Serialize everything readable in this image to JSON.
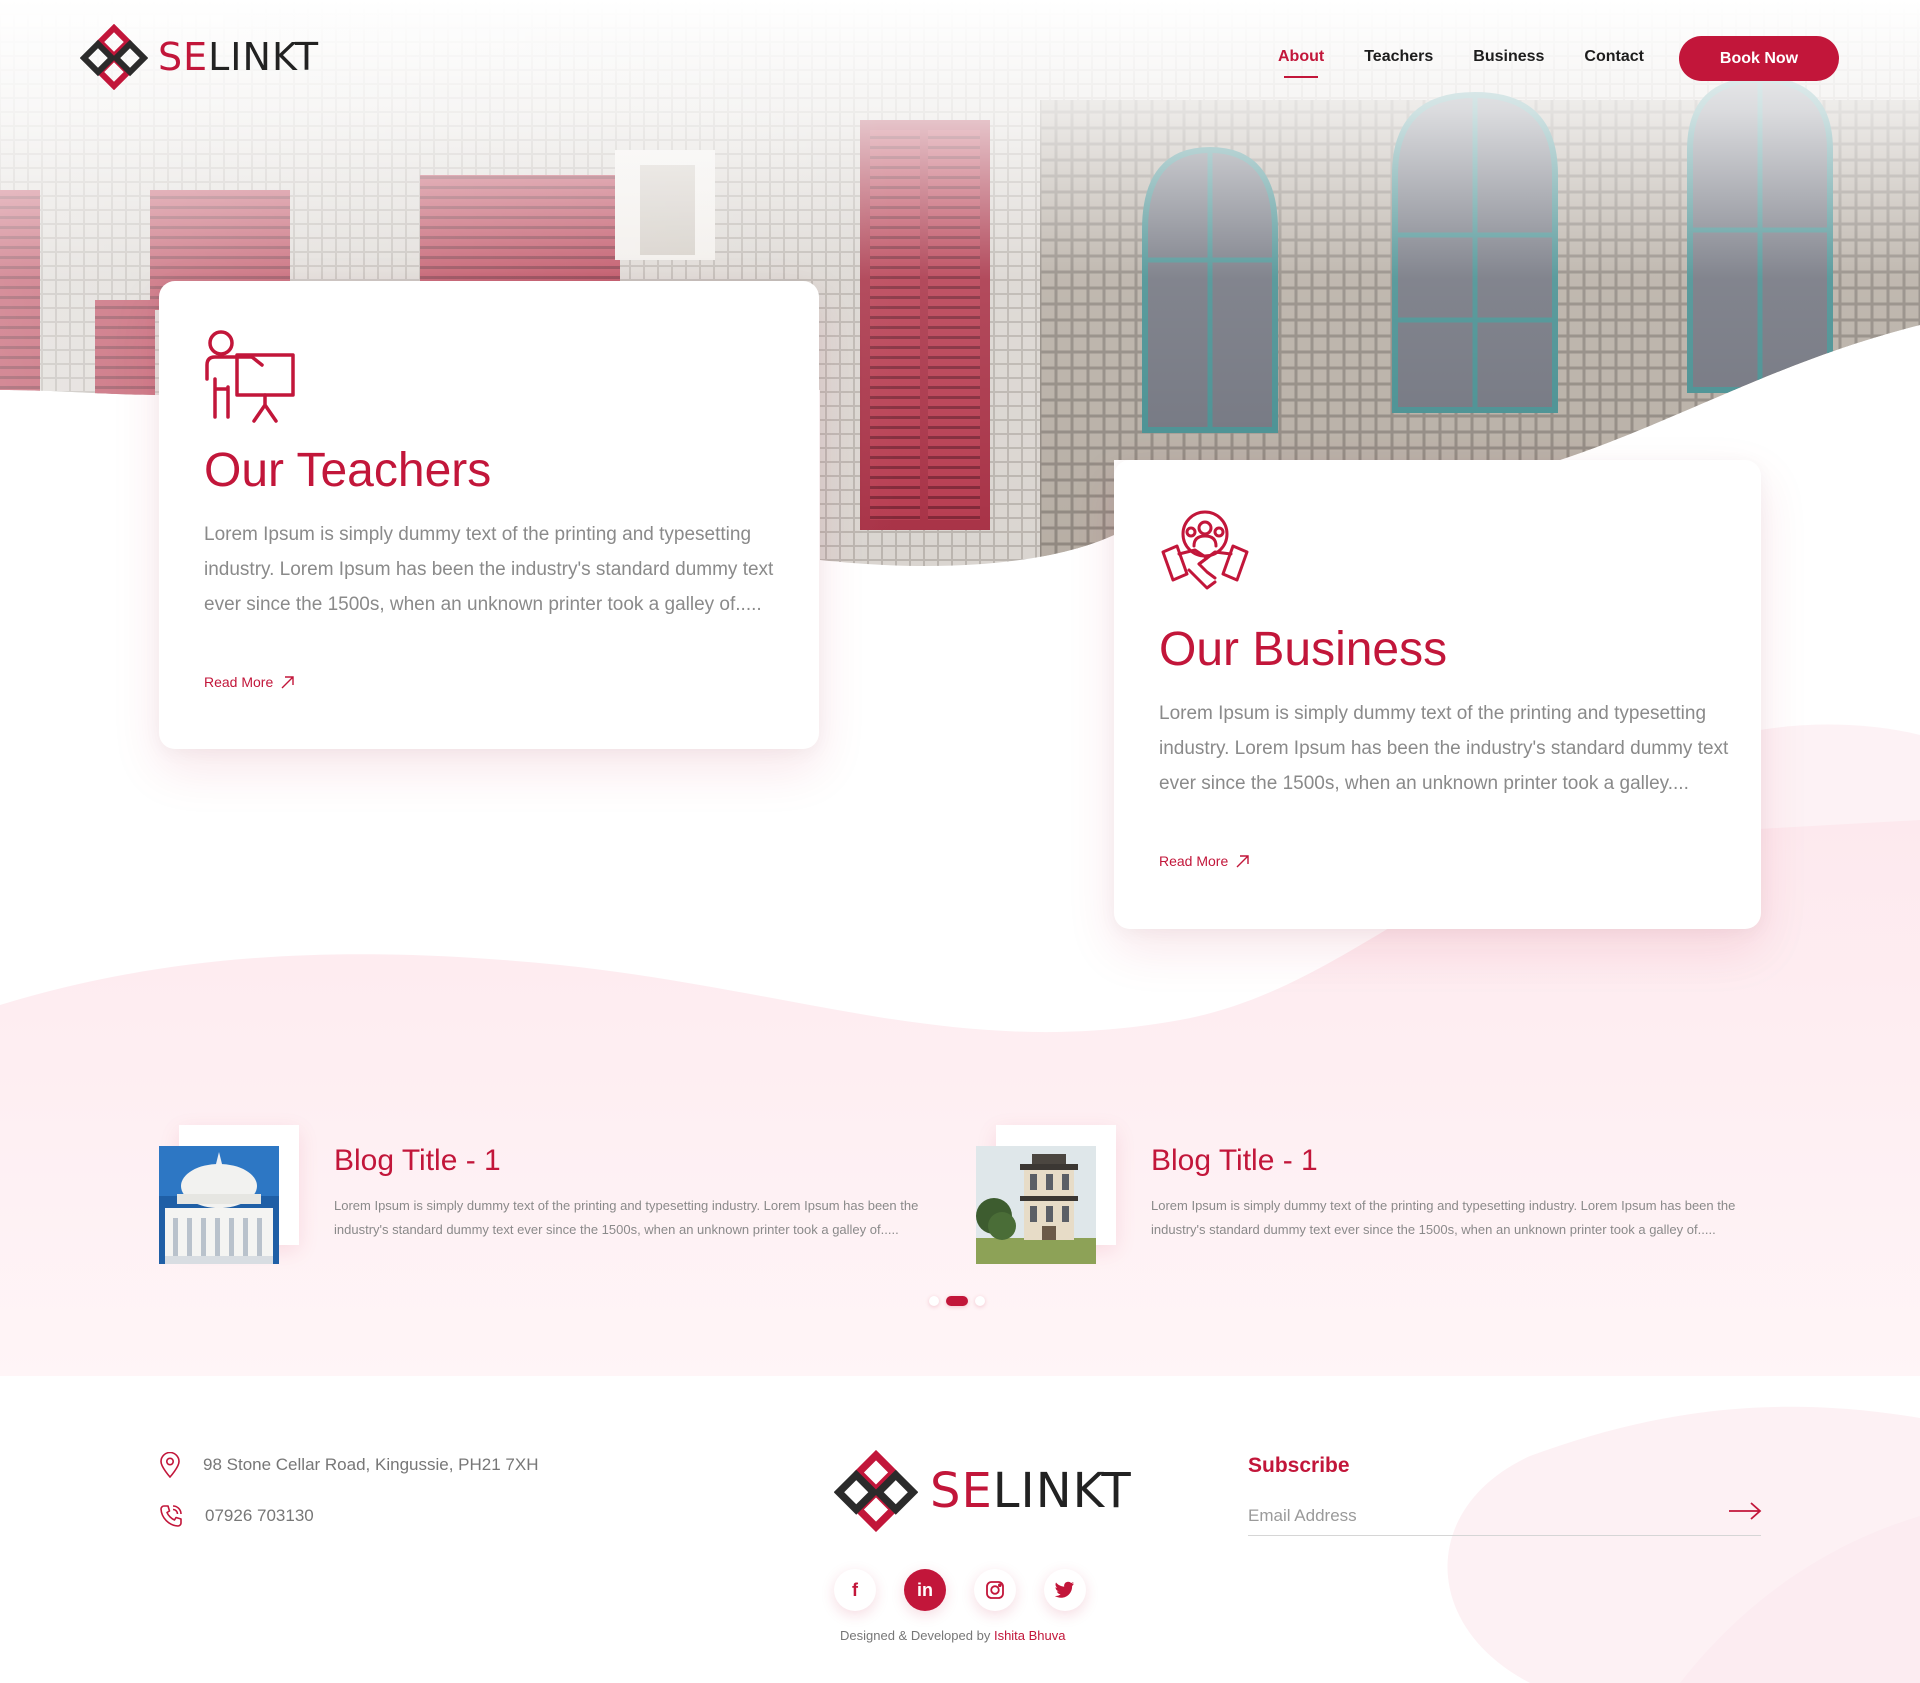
{
  "brand": {
    "name_prefix": "SE",
    "name_suffix": "LINKT",
    "accent": "#c2163a"
  },
  "nav": {
    "links": [
      {
        "label": "About",
        "active": true
      },
      {
        "label": "Teachers",
        "active": false
      },
      {
        "label": "Business",
        "active": false
      },
      {
        "label": "Contact",
        "active": false
      }
    ],
    "cta": "Book Now"
  },
  "cards": {
    "teachers": {
      "icon": "teacher-board-icon",
      "title": "Our Teachers",
      "text": "Lorem Ipsum is simply dummy text of the printing and typesetting industry. Lorem Ipsum has been the industry's standard dummy text ever since the 1500s, when an unknown printer took a galley of.....",
      "link": "Read More"
    },
    "business": {
      "icon": "business-handshake-icon",
      "title": "Our Business",
      "text": "Lorem Ipsum is simply dummy text of the printing and typesetting industry. Lorem Ipsum has been the industry's standard dummy text ever since the 1500s, when an unknown printer took a galley....",
      "link": "Read More"
    }
  },
  "blog": [
    {
      "title": "Blog Title - 1",
      "text": "Lorem Ipsum is simply dummy text of the printing and typesetting industry. Lorem Ipsum has been the industry's standard dummy text ever since the 1500s, when an unknown printer took a galley of.....",
      "image": "tower-balcony-image"
    },
    {
      "title": "Blog Title - 1",
      "text": "Lorem Ipsum is simply dummy text of the printing and typesetting industry. Lorem Ipsum has been the industry's standard dummy text ever since the 1500s, when an unknown printer took a galley of.....",
      "image": "mansion-image"
    }
  ],
  "carousel": {
    "count": 3,
    "active_index": 1
  },
  "footer": {
    "address": "98 Stone Cellar Road, Kingussie, PH21 7XH",
    "phone": "07926 703130",
    "socials": [
      {
        "name": "facebook-icon",
        "glyph": "f",
        "active": false
      },
      {
        "name": "linkedin-icon",
        "glyph": "in",
        "active": true
      },
      {
        "name": "instagram-icon",
        "glyph": "",
        "active": false
      },
      {
        "name": "twitter-icon",
        "glyph": "",
        "active": false
      }
    ],
    "credit_prefix": "Designed & Developed by",
    "credit_name": "Ishita Bhuva",
    "subscribe_title": "Subscribe",
    "email_placeholder": "Email Address"
  }
}
